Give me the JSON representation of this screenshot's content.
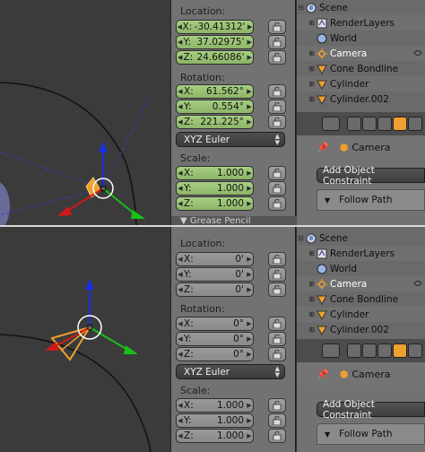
{
  "panels": [
    {
      "location_label": "Location:",
      "location": [
        {
          "axis": "X:",
          "value": "-30.41312'"
        },
        {
          "axis": "Y:",
          "value": "37.02975'"
        },
        {
          "axis": "Z:",
          "value": "24.66086'"
        }
      ],
      "rotation_label": "Rotation:",
      "rotation": [
        {
          "axis": "X:",
          "value": "61.562°"
        },
        {
          "axis": "Y:",
          "value": "0.554°"
        },
        {
          "axis": "Z:",
          "value": "221.225°"
        }
      ],
      "rotation_mode": "XYZ Euler",
      "scale_label": "Scale:",
      "scale": [
        {
          "axis": "X:",
          "value": "1.000"
        },
        {
          "axis": "Y:",
          "value": "1.000"
        },
        {
          "axis": "Z:",
          "value": "1.000"
        }
      ],
      "next_panel": "Grease Pencil"
    },
    {
      "location_label": "Location:",
      "location": [
        {
          "axis": "X:",
          "value": "0'"
        },
        {
          "axis": "Y:",
          "value": "0'"
        },
        {
          "axis": "Z:",
          "value": "0'"
        }
      ],
      "rotation_label": "Rotation:",
      "rotation": [
        {
          "axis": "X:",
          "value": "0°"
        },
        {
          "axis": "Y:",
          "value": "0°"
        },
        {
          "axis": "Z:",
          "value": "0°"
        }
      ],
      "rotation_mode": "XYZ Euler",
      "scale_label": "Scale:",
      "scale": [
        {
          "axis": "X:",
          "value": "1.000"
        },
        {
          "axis": "Y:",
          "value": "1.000"
        },
        {
          "axis": "Z:",
          "value": "1.000"
        }
      ]
    }
  ],
  "outliner": {
    "items": [
      "Scene",
      "RenderLayers",
      "World",
      "Camera",
      "Cone Bondline",
      "Cylinder",
      "Cylinder.002"
    ],
    "selected": "Camera"
  },
  "properties": {
    "object_name": "Camera",
    "add_constraint_label": "Add Object Constraint",
    "constraint_name": "Follow Path"
  },
  "colors": {
    "field_green": "#9bc376",
    "field_grey": "#939393",
    "selection_orange": "#f0a030",
    "axis_x": "#d01818",
    "axis_y": "#18c018",
    "axis_z": "#1830e0"
  }
}
